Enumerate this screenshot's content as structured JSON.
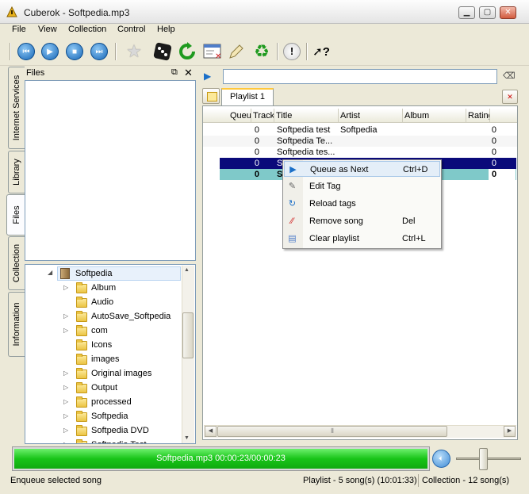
{
  "window": {
    "title": "Cuberok - Softpedia.mp3"
  },
  "menu": [
    "File",
    "View",
    "Collection",
    "Control",
    "Help"
  ],
  "side_tabs": [
    "Internet Services",
    "Library",
    "Files",
    "Collection",
    "Information"
  ],
  "files_panel": {
    "title": "Files",
    "tree_root": "Softpedia",
    "tree_items": [
      {
        "label": "Album",
        "expandable": true
      },
      {
        "label": "Audio",
        "expandable": false
      },
      {
        "label": "AutoSave_Softpedia",
        "expandable": true
      },
      {
        "label": "com",
        "expandable": true
      },
      {
        "label": "Icons",
        "expandable": false
      },
      {
        "label": "images",
        "expandable": false
      },
      {
        "label": "Original images",
        "expandable": true
      },
      {
        "label": "Output",
        "expandable": true
      },
      {
        "label": "processed",
        "expandable": true
      },
      {
        "label": "Softpedia",
        "expandable": true
      },
      {
        "label": "Softpedia DVD",
        "expandable": true
      },
      {
        "label": "Softpedia Test",
        "expandable": true
      }
    ]
  },
  "search": {
    "value": ""
  },
  "playlist": {
    "tab_label": "Playlist 1",
    "columns": [
      "Queue",
      "Track",
      "Title",
      "Artist",
      "Album",
      "Rating"
    ],
    "rows": [
      {
        "queue": "",
        "track": "0",
        "title": "Softpedia test",
        "artist": "Softpedia",
        "album": "",
        "rating": "0",
        "state": "normal"
      },
      {
        "queue": "",
        "track": "0",
        "title": "Softpedia Te...",
        "artist": "",
        "album": "",
        "rating": "0",
        "state": "alt"
      },
      {
        "queue": "",
        "track": "0",
        "title": "Softpedia tes...",
        "artist": "",
        "album": "",
        "rating": "0",
        "state": "normal"
      },
      {
        "queue": "",
        "track": "0",
        "title": "S",
        "artist": "",
        "album": "",
        "rating": "0",
        "state": "selected"
      },
      {
        "queue": "",
        "track": "0",
        "title": "S",
        "artist": "",
        "album": "",
        "rating": "0",
        "state": "current"
      }
    ]
  },
  "context_menu": [
    {
      "label": "Queue as Next",
      "shortcut": "Ctrl+D",
      "icon": "queue-arrow-icon",
      "highlighted": true
    },
    {
      "label": "Edit Tag",
      "shortcut": "",
      "icon": "edit-tag-icon",
      "highlighted": false
    },
    {
      "label": "Reload tags",
      "shortcut": "",
      "icon": "reload-icon",
      "highlighted": false
    },
    {
      "label": "Remove song",
      "shortcut": "Del",
      "icon": "remove-icon",
      "highlighted": false
    },
    {
      "label": "Clear playlist",
      "shortcut": "Ctrl+L",
      "icon": "clear-playlist-icon",
      "highlighted": false
    }
  ],
  "player": {
    "progress_text": "Softpedia.mp3 00:00:23/00:00:23",
    "progress_fraction": 1.0,
    "volume_fraction": 0.42
  },
  "status": {
    "left": "Enqueue selected song",
    "playlist": "Playlist - 5 song(s) (10:01:33)",
    "collection": "Collection - 12 song(s)"
  },
  "colors": {
    "selected_row": "#0A0A7A",
    "current_row": "#7FC9C9",
    "progress": "#18C418"
  }
}
